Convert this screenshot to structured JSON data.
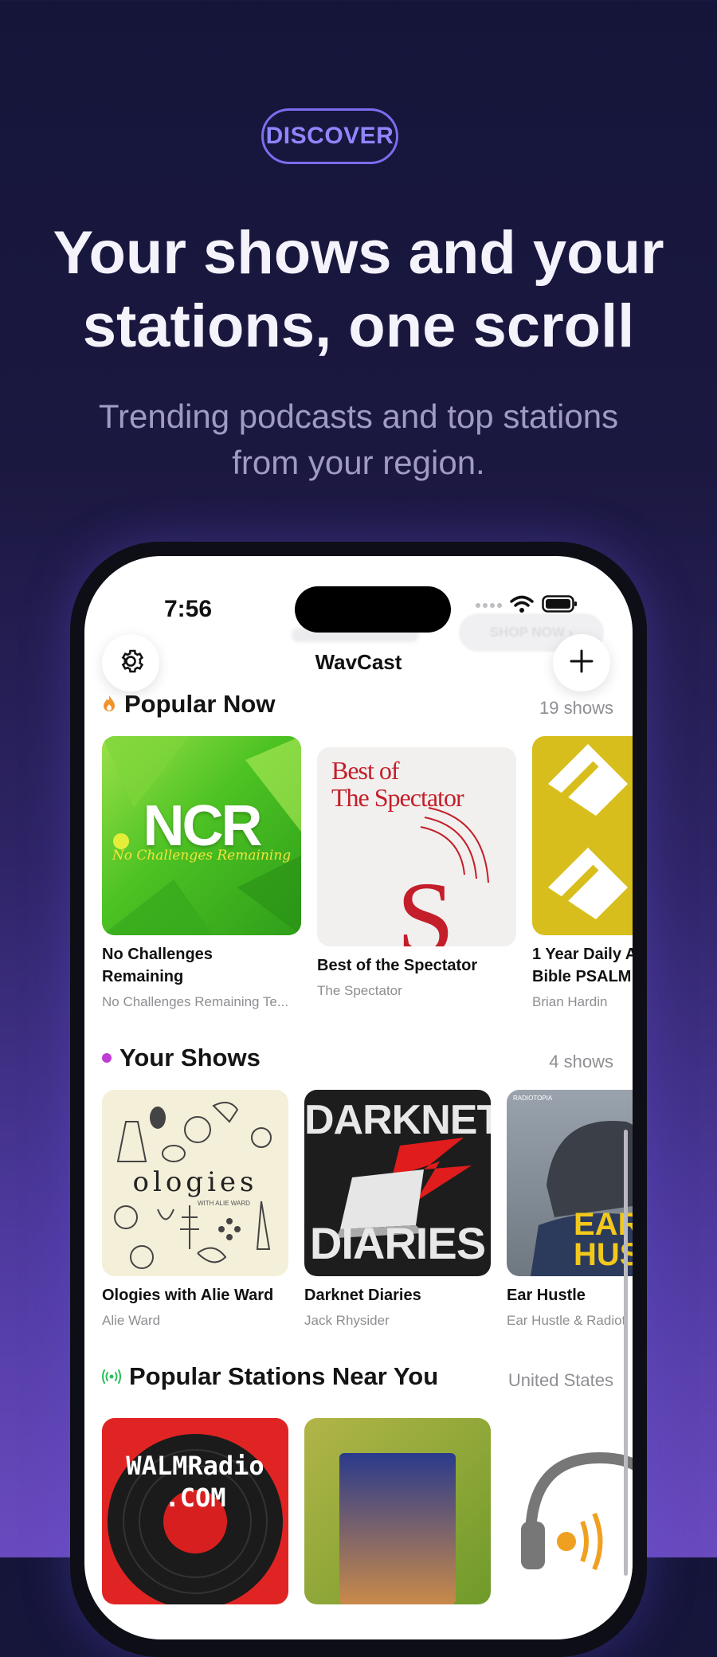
{
  "promo": {
    "badge": "DISCOVER",
    "headline_line1": "Your shows and your",
    "headline_line2": "stations, one scroll",
    "subhead_line1": "Trending podcasts and top stations",
    "subhead_line2": "from your region."
  },
  "status_bar": {
    "time": "7:56"
  },
  "app": {
    "title": "WavCast",
    "ghost_button": "SHOP NOW ›"
  },
  "sections": {
    "popular": {
      "title": "Popular Now",
      "count": "19 shows",
      "items": [
        {
          "title_line1": "No Challenges",
          "title_line2": "Remaining",
          "subtitle": "No Challenges Remaining Te...",
          "art_text": "NCR",
          "art_script": "No Challenges Remaining"
        },
        {
          "title_line1": "Best of the Spectator",
          "title_line2": "",
          "subtitle": "The Spectator",
          "art_line1": "Best of",
          "art_line2": "The Spectator",
          "art_letter": "S"
        },
        {
          "title_line1": "1 Year Daily A",
          "title_line2": "Bible PSALM",
          "subtitle": "Brian Hardin"
        }
      ]
    },
    "your_shows": {
      "title": "Your Shows",
      "count": "4 shows",
      "items": [
        {
          "title": "Ologies with Alie Ward",
          "subtitle": "Alie Ward",
          "art_text": "ologies",
          "art_small": "WITH ALIE WARD"
        },
        {
          "title": "Darknet Diaries",
          "subtitle": "Jack Rhysider",
          "art_line1": "DARKNET",
          "art_line2": "DIARIES"
        },
        {
          "title": "Ear Hustle",
          "subtitle": "Ear Hustle & Radiot",
          "art_line1": "EAR",
          "art_line2": "HUST",
          "art_small": "RADIOTOPIA"
        }
      ]
    },
    "stations": {
      "title": "Popular Stations Near You",
      "region": "United States",
      "items": [
        {
          "art_line1": "WALMRadio",
          "art_line2": ".COM"
        },
        {},
        {}
      ]
    }
  },
  "colors": {
    "accent": "#7a6df0",
    "popular_icon": "#f0932b",
    "your_shows_dot": "#c03cd6",
    "stations_icon": "#2ebd59"
  }
}
